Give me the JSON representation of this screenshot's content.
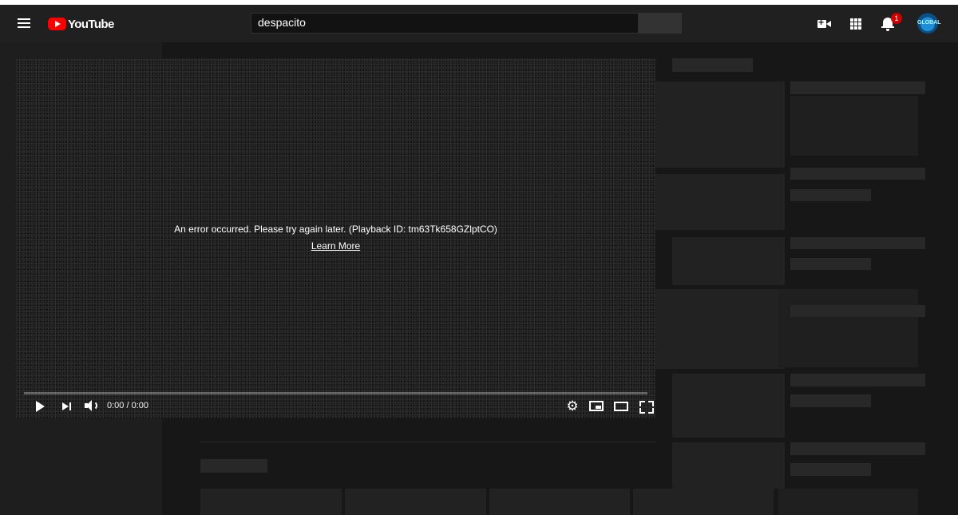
{
  "masthead": {
    "logo_text": "YouTube",
    "search_value": "despacito",
    "notification_count": "1",
    "avatar_text": "GLOBAL",
    "icons": [
      "menu-icon",
      "youtube-logo-icon",
      "create-video-icon",
      "apps-grid-icon",
      "notifications-bell-icon"
    ]
  },
  "player": {
    "error_message": "An error occurred. Please try again later. (Playback ID: tm63Tk658GZlptCO)",
    "learn_more_label": "Learn More",
    "time": "0:00 / 0:00",
    "settings_glyph": "⚙",
    "controls": [
      "play-icon",
      "next-icon",
      "volume-icon",
      "settings-icon",
      "miniplayer-icon",
      "theater-icon",
      "fullscreen-icon"
    ]
  },
  "colors": {
    "accent": "#ff0000",
    "masthead": "#202020",
    "background": "#181818",
    "badge": "#cc0000"
  }
}
